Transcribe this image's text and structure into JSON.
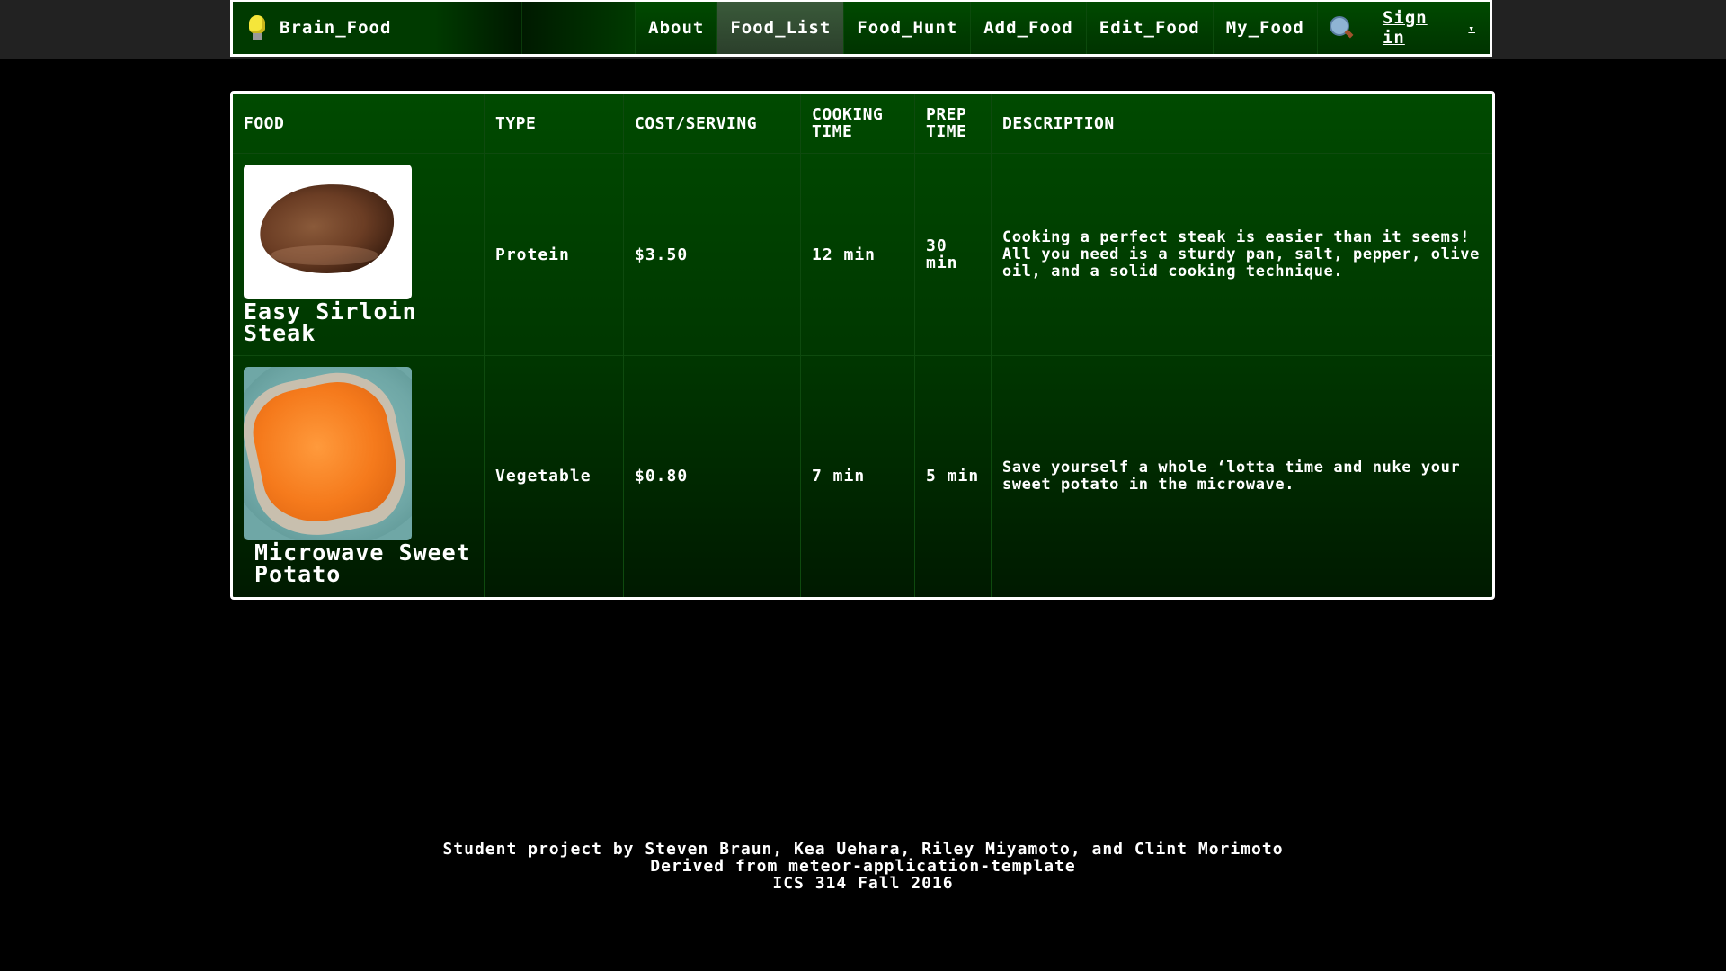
{
  "navbar": {
    "brand_label": "Brain_Food",
    "items": [
      {
        "label": "About",
        "active": false
      },
      {
        "label": "Food_List",
        "active": true
      },
      {
        "label": "Food_Hunt",
        "active": false
      },
      {
        "label": "Add_Food",
        "active": false
      },
      {
        "label": "Edit_Food",
        "active": false
      },
      {
        "label": "My_Food",
        "active": false
      }
    ],
    "search_icon": "magnifying-glass-icon",
    "signin_label": "Sign in",
    "signin_caret": "▾"
  },
  "table": {
    "headers": {
      "food": "FOOD",
      "type": "TYPE",
      "cost": "COST/SERVING",
      "cooking_line1": "COOKING",
      "cooking_line2": "TIME",
      "prep_line1": "PREP",
      "prep_line2": "TIME",
      "description": "DESCRIPTION"
    },
    "rows": [
      {
        "name": "Easy Sirloin Steak",
        "image": "steak-image",
        "type": "Protein",
        "cost": "$3.50",
        "cooking_time": "12 min",
        "prep_time": "30 min",
        "description": "Cooking a perfect steak is easier than it seems! All you need is a sturdy pan, salt, pepper, olive oil, and a solid cooking technique."
      },
      {
        "name": "Microwave Sweet Potato",
        "image": "sweet-potato-image",
        "type": "Vegetable",
        "cost": "$0.80",
        "cooking_time": "7 min",
        "prep_time": "5 min",
        "description": "Save yourself a whole ‘lotta time and nuke your sweet potato in the microwave."
      }
    ]
  },
  "footer": {
    "line1": "Student project by Steven Braun, Kea Uehara, Riley Miyamoto, and Clint Morimoto",
    "line2": "Derived from meteor-application-template",
    "line3": "ICS 314 Fall 2016"
  },
  "colors": {
    "background": "#000000",
    "top_strip": "#222222",
    "panel_green": "#004a00",
    "border": "#ffffff",
    "active_tab": "#3a5a3a"
  }
}
